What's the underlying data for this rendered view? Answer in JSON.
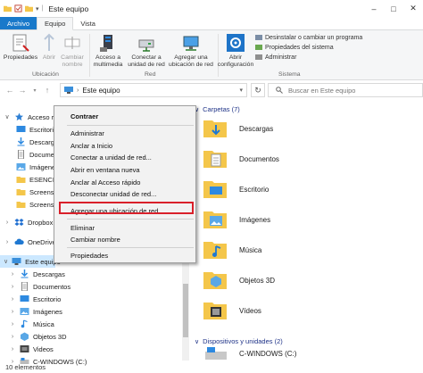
{
  "window": {
    "title": "Este equipo",
    "controls": [
      "–",
      "□",
      "✕"
    ]
  },
  "ribbon_tabs": [
    {
      "label": "Archivo"
    },
    {
      "label": "Equipo"
    },
    {
      "label": "Vista"
    }
  ],
  "ribbon": {
    "ubicacion": {
      "label": "Ubicación",
      "buttons": [
        "Propiedades",
        "Abrir",
        "Cambiar nombre"
      ]
    },
    "red": {
      "label": "Red",
      "buttons": [
        "Acceso a multimedia",
        "Conectar a unidad de red",
        "Agregar una ubicación de red"
      ]
    },
    "sistema": {
      "label": "Sistema",
      "open_settings": "Abrir configuración",
      "small_buttons": [
        "Desinstalar o cambiar un programa",
        "Propiedades del sistema",
        "Administrar"
      ]
    }
  },
  "address": {
    "path": "Este equipo",
    "search_placeholder": "Buscar en Este equipo"
  },
  "nav_pane": {
    "items": [
      {
        "label": "Acceso rápido"
      },
      {
        "label": "Escritorio"
      },
      {
        "label": "Descargas"
      },
      {
        "label": "Documentos"
      },
      {
        "label": "Imágenes"
      },
      {
        "label": "ESENCIAL"
      },
      {
        "label": "Screenshots"
      },
      {
        "label": "Screenshots"
      },
      {
        "label": "Dropbox"
      },
      {
        "label": "OneDrive"
      },
      {
        "label": "Este equipo"
      },
      {
        "label": "Descargas"
      },
      {
        "label": "Documentos"
      },
      {
        "label": "Escritorio"
      },
      {
        "label": "Imágenes"
      },
      {
        "label": "Música"
      },
      {
        "label": "Objetos 3D"
      },
      {
        "label": "Videos"
      },
      {
        "label": "C-WINDOWS (C:)"
      }
    ],
    "visible_labels": [
      "Acceso rá",
      "Escritori",
      "Descarg",
      "Docume",
      "Imágene",
      "ESENCIA",
      "Screensh",
      "Screensh",
      "Dropbox",
      "OneDrive",
      "Este equipo",
      "Descargas",
      "Documentos",
      "Escritorio",
      "Imágenes",
      "Música",
      "Objetos 3D",
      "Videos",
      "C-WINDOWS (C:)"
    ]
  },
  "content": {
    "folders_header": "Carpetas (7)",
    "folders": [
      "Descargas",
      "Documentos",
      "Escritorio",
      "Imágenes",
      "Música",
      "Objetos 3D",
      "Vídeos"
    ],
    "drives_header": "Dispositivos y unidades (2)",
    "drives": [
      "C-WINDOWS (C:)"
    ]
  },
  "context_menu": {
    "items": [
      {
        "label": "Contraer",
        "bold": true
      },
      {
        "label": "Administrar"
      },
      {
        "label": "Anclar a Inicio"
      },
      {
        "label": "Conectar a unidad de red..."
      },
      {
        "label": "Abrir en ventana nueva"
      },
      {
        "label": "Anclar al Acceso rápido"
      },
      {
        "label": "Desconectar unidad de red..."
      },
      {
        "label": "Agregar una ubicación de red",
        "highlighted": true
      },
      {
        "label": "Eliminar"
      },
      {
        "label": "Cambiar nombre"
      },
      {
        "label": "Propiedades"
      }
    ],
    "highlight_color": "#d9202a"
  },
  "status": {
    "count": "10 elementos"
  },
  "colors": {
    "file_tab": "#1979ca",
    "selection": "#cce8ff",
    "folder_yellow": "#f4c64a",
    "header_text": "#1e3287"
  }
}
